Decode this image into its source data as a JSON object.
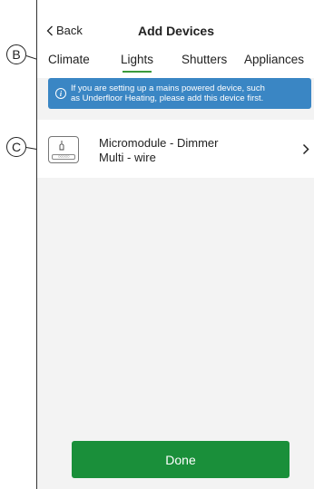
{
  "header": {
    "back_label": "Back",
    "title": "Add Devices"
  },
  "tabs": [
    {
      "label": "Climate",
      "active": false
    },
    {
      "label": "Lights",
      "active": true
    },
    {
      "label": "Shutters",
      "active": false
    },
    {
      "label": "Appliances",
      "active": false
    }
  ],
  "banner": {
    "icon": "info-icon",
    "line1": "If you are setting up a mains powered device, such",
    "line2": "as Underfloor Heating, please add this device first."
  },
  "devices": [
    {
      "name_line1": "Micromodule - Dimmer",
      "name_line2": "Multi - wire",
      "icon": "micromodule-light-icon"
    }
  ],
  "footer": {
    "done_label": "Done"
  },
  "callouts": {
    "b": "B",
    "c": "C"
  },
  "colors": {
    "accent_green": "#1a8f3a",
    "banner_blue": "#3a86c4",
    "tab_underline": "#3b9a3b"
  }
}
